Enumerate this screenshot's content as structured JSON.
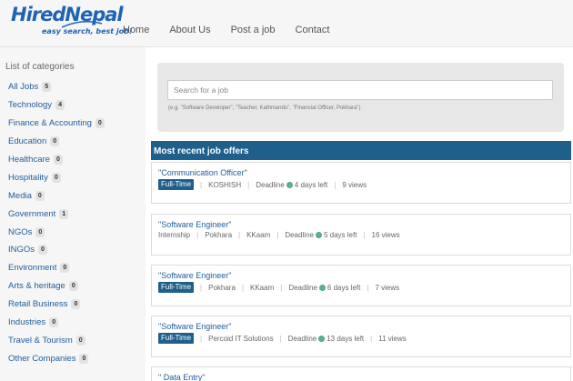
{
  "brand": {
    "name": "HiredNepal",
    "tagline": "easy search, best job!"
  },
  "nav": [
    "Home",
    "About Us",
    "Post a job",
    "Contact"
  ],
  "sidebar": {
    "title": "List of categories",
    "categories": [
      {
        "label": "All Jobs",
        "count": "5"
      },
      {
        "label": "Technology",
        "count": "4"
      },
      {
        "label": "Finance & Accounting",
        "count": "0"
      },
      {
        "label": "Education",
        "count": "0"
      },
      {
        "label": "Healthcare",
        "count": "0"
      },
      {
        "label": "Hospitality",
        "count": "0"
      },
      {
        "label": "Media",
        "count": "0"
      },
      {
        "label": "Government",
        "count": "1"
      },
      {
        "label": "NGOs",
        "count": "0"
      },
      {
        "label": "INGOs",
        "count": "0"
      },
      {
        "label": "Environment",
        "count": "0"
      },
      {
        "label": "Arts & heritage",
        "count": "0"
      },
      {
        "label": "Retail Business",
        "count": "0"
      },
      {
        "label": "Industries",
        "count": "0"
      },
      {
        "label": "Travel & Tourism",
        "count": "0"
      },
      {
        "label": "Other Companies",
        "count": "0"
      }
    ]
  },
  "search": {
    "placeholder": "Search for a job",
    "hint": "(e.g. \"Software Developer\", \"Teacher, Kathmandu\", \"Financial Officer, Pokhara\")"
  },
  "recent": {
    "title": "Most recent job offers",
    "jobs": [
      {
        "title": "\"Communication Officer\"",
        "type": "Full-Time",
        "type_badge": true,
        "location": "",
        "company": "KOSHISH",
        "deadline_label": "Deadline",
        "deadline": "4 days left",
        "views": "9 views"
      },
      {
        "title": "\"Software Engineer\"",
        "type": "Internship",
        "type_badge": false,
        "location": "Pokhara",
        "company": "KKaam",
        "deadline_label": "Deadline",
        "deadline": "5 days left",
        "views": "16 views"
      },
      {
        "title": "\"Software Engineer\"",
        "type": "Full-Time",
        "type_badge": true,
        "location": "Pokhara",
        "company": "KKaam",
        "deadline_label": "Deadline",
        "deadline": "6 days left",
        "views": "7 views"
      },
      {
        "title": "\"Software Engineer\"",
        "type": "Full-Time",
        "type_badge": true,
        "location": "",
        "company": "Percoid IT Solutions",
        "deadline_label": "Deadline",
        "deadline": "13 days left",
        "views": "11 views"
      },
      {
        "title": "\" Data Entry\""
      }
    ]
  },
  "colors": {
    "brand": "#1f64b4",
    "accent": "#1e5f8c",
    "link": "#1f5e9b"
  }
}
